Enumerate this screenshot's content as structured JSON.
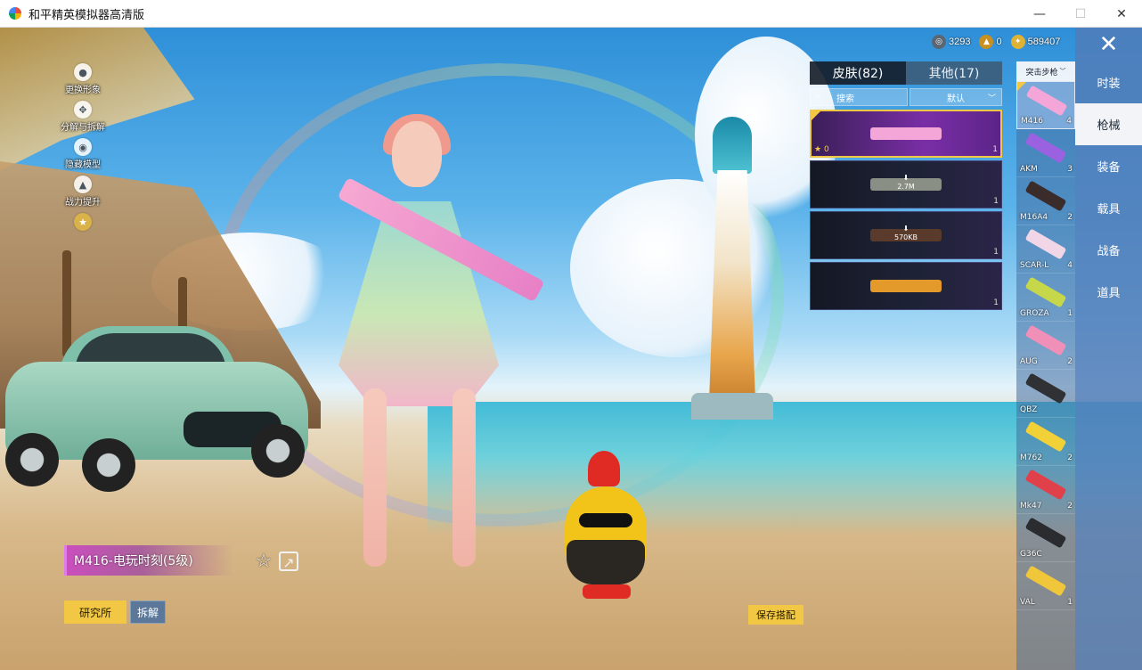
{
  "window": {
    "title": "和平精英模拟器高清版",
    "minimize_glyph": "—",
    "maximize_glyph": "☐",
    "close_glyph": "✕"
  },
  "left_menu": [
    {
      "label": "更换形象",
      "icon": "person-icon"
    },
    {
      "label": "分解与拆解",
      "icon": "scatter-icon"
    },
    {
      "label": "隐藏模型",
      "icon": "eye-icon"
    },
    {
      "label": "战力提升",
      "icon": "flame-icon"
    },
    {
      "label": "",
      "icon": "gold-medal-icon"
    }
  ],
  "currency": [
    {
      "value": "3293",
      "icon": "silver-coin-icon",
      "color": "#5b6673"
    },
    {
      "value": "0",
      "icon": "token-icon",
      "color": "#c98f1f"
    },
    {
      "value": "589407",
      "icon": "gold-coin-icon",
      "color": "#e0b234"
    }
  ],
  "skin_panel": {
    "tabs": [
      {
        "label": "皮肤(82)",
        "active": true
      },
      {
        "label": "其他(17)",
        "active": false
      }
    ],
    "search_placeholder": "搜索",
    "sort_label": "默认",
    "cards": [
      {
        "selected": true,
        "star_count": "0",
        "count": "1",
        "download": "",
        "color": "#f3a6d7"
      },
      {
        "selected": false,
        "star_count": "",
        "count": "1",
        "download": "2.7M",
        "color": "#8a8f86"
      },
      {
        "selected": false,
        "star_count": "",
        "count": "1",
        "download": "570KB",
        "color": "#5a3a2a"
      },
      {
        "selected": false,
        "star_count": "",
        "count": "1",
        "download": "",
        "color": "#e39a2a"
      }
    ]
  },
  "weapon_list": {
    "type_label": "突击步枪",
    "items": [
      {
        "name": "M416",
        "count": "4",
        "selected": true,
        "color": "#f3a6d7"
      },
      {
        "name": "AKM",
        "count": "3",
        "selected": false,
        "color": "#9a62e0"
      },
      {
        "name": "M16A4",
        "count": "2",
        "selected": false,
        "color": "#3b2c2c"
      },
      {
        "name": "SCAR-L",
        "count": "4",
        "selected": false,
        "color": "#f0d6e6"
      },
      {
        "name": "GROZA",
        "count": "1",
        "selected": false,
        "color": "#c6d84a"
      },
      {
        "name": "AUG",
        "count": "2",
        "selected": false,
        "color": "#f08fb8"
      },
      {
        "name": "QBZ",
        "count": "",
        "selected": false,
        "color": "#2f3134"
      },
      {
        "name": "M762",
        "count": "2",
        "selected": false,
        "color": "#f2d038"
      },
      {
        "name": "Mk47",
        "count": "2",
        "selected": false,
        "color": "#e0404a"
      },
      {
        "name": "G36C",
        "count": "",
        "selected": false,
        "color": "#2a2c2f"
      },
      {
        "name": "VAL",
        "count": "1",
        "selected": false,
        "color": "#f0c63a"
      }
    ]
  },
  "categories": {
    "close_glyph": "✕",
    "tabs": [
      {
        "label": "时装",
        "active": false
      },
      {
        "label": "枪械",
        "active": true
      },
      {
        "label": "装备",
        "active": false
      },
      {
        "label": "载具",
        "active": false
      },
      {
        "label": "战备",
        "active": false
      },
      {
        "label": "道具",
        "active": false
      }
    ]
  },
  "bottom": {
    "skin_name": "M416-电玩时刻(5级)",
    "research_label": "研究所",
    "dismantle_label": "拆解",
    "save_label": "保存搭配",
    "fav_glyph": "☆",
    "share_glyph": "↗"
  }
}
